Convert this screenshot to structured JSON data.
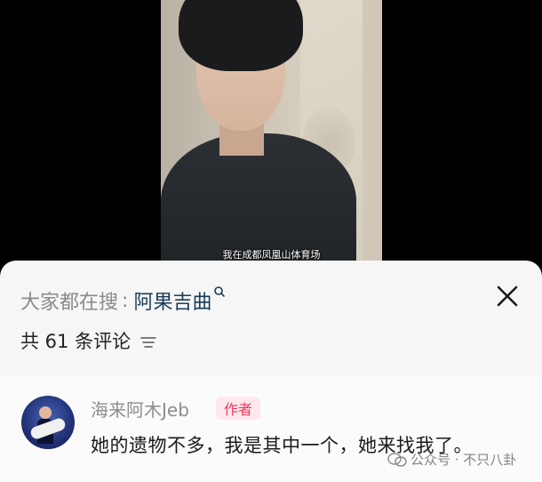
{
  "video": {
    "subtitle": "我在成都凤凰山体育场"
  },
  "search": {
    "label": "大家都在搜",
    "colon": ":",
    "term": "阿果吉曲"
  },
  "comments": {
    "count_text": "共 61 条评论",
    "items": [
      {
        "username": "海来阿木Jeb",
        "badge": "作者",
        "text": "她的遗物不多，我是其中一个，她来找我了。"
      }
    ]
  },
  "watermark": {
    "text": "公众号 · 不只八卦"
  },
  "colors": {
    "sheet_bg": "#f6f6f6",
    "search_term": "#1a3b56",
    "badge_text": "#f03a5f",
    "badge_bg": "#fde8ec"
  },
  "icons": [
    "search-icon",
    "close-icon",
    "sort-icon",
    "wechat-icon"
  ]
}
